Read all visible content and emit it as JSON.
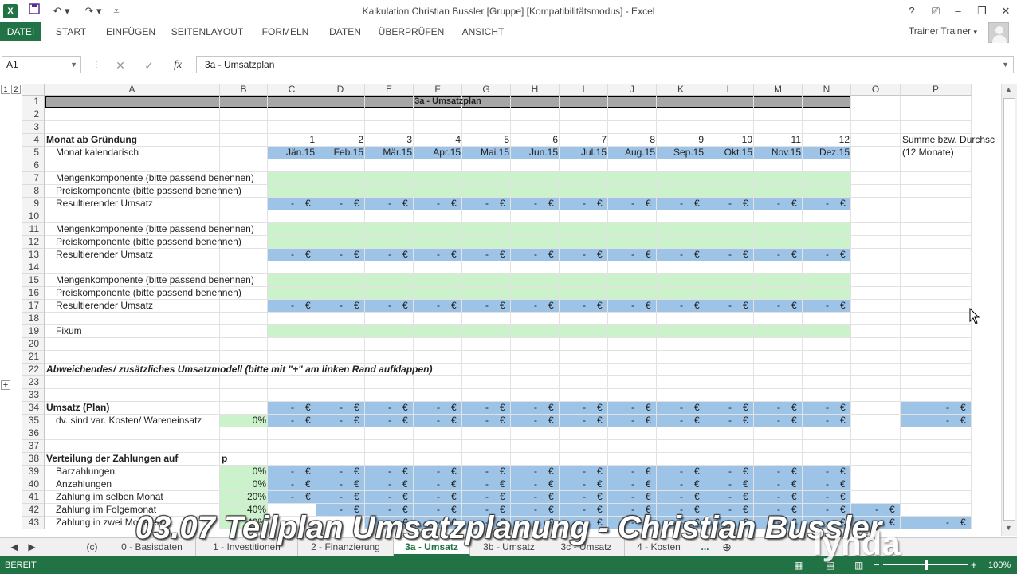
{
  "title_bar": {
    "app_logo": "X",
    "window_title": "Kalkulation Christian Bussler  [Gruppe]  [Kompatibilitätsmodus] - Excel",
    "help": "?",
    "restore_ribbon": "⎚",
    "minimize": "–",
    "maximize": "❐",
    "close": "✕"
  },
  "ribbon": {
    "tabs": [
      "DATEI",
      "START",
      "EINFÜGEN",
      "SEITENLAYOUT",
      "FORMELN",
      "DATEN",
      "ÜBERPRÜFEN",
      "ANSICHT"
    ],
    "active_tab": "DATEI",
    "user": "Trainer Trainer"
  },
  "formula_bar": {
    "name_box": "A1",
    "cancel": "✕",
    "confirm": "✓",
    "fx": "fx",
    "value": "3a - Umsatzplan"
  },
  "outline": {
    "level1": "1",
    "level2": "2",
    "expand": "+"
  },
  "columns": [
    "A",
    "B",
    "C",
    "D",
    "E",
    "F",
    "G",
    "H",
    "I",
    "J",
    "K",
    "L",
    "M",
    "N",
    "O",
    "P"
  ],
  "rows": [
    "1",
    "2",
    "3",
    "4",
    "5",
    "6",
    "7",
    "8",
    "9",
    "10",
    "11",
    "12",
    "13",
    "14",
    "15",
    "16",
    "17",
    "18",
    "19",
    "20",
    "21",
    "22",
    "23",
    "33",
    "34",
    "35",
    "36",
    "37",
    "38",
    "39",
    "40",
    "41",
    "42",
    "43"
  ],
  "cells": {
    "r1_title": "3a - Umsatzplan",
    "r4_a": "Monat ab Gründung",
    "r4_months": [
      "1",
      "2",
      "3",
      "4",
      "5",
      "6",
      "7",
      "8",
      "9",
      "10",
      "11",
      "12"
    ],
    "r4_p": "Summe bzw. Durchschnitt",
    "r5_a": "Monat kalendarisch",
    "r5_months": [
      "Jän.15",
      "Feb.15",
      "Mär.15",
      "Apr.15",
      "Mai.15",
      "Jun.15",
      "Jul.15",
      "Aug.15",
      "Sep.15",
      "Okt.15",
      "Nov.15",
      "Dez.15"
    ],
    "r5_p": "(12 Monate)",
    "r7_a": "Mengenkomponente (bitte passend benennen)",
    "r8_a": "Preiskomponente (bitte passend benennen)",
    "r9_a": "Resultierender Umsatz",
    "r11_a": "Mengenkomponente (bitte passend benennen)",
    "r12_a": "Preiskomponente (bitte passend benennen)",
    "r13_a": "Resultierender Umsatz",
    "r15_a": "Mengenkomponente (bitte passend benennen)",
    "r16_a": "Preiskomponente (bitte passend benennen)",
    "r17_a": "Resultierender Umsatz",
    "r19_a": "Fixum",
    "r22_a": "Abweichendes/ zusätzliches Umsatzmodell (bitte mit \"+\" am linken Rand aufklappen)",
    "r34_a": "Umsatz (Plan)",
    "r35_a": "dv. sind var. Kosten/ Wareneinsatz",
    "r35_b": "0%",
    "r38_a": "Verteilung der Zahlungen auf",
    "r38_b": "p",
    "r39_a": "Barzahlungen",
    "r39_b": "0%",
    "r40_a": "Anzahlungen",
    "r40_b": "0%",
    "r41_a": "Zahlung im selben Monat",
    "r41_b": "20%",
    "r42_a": "Zahlung im Folgemonat",
    "r42_b": "40%",
    "r43_a": "Zahlung in zwei Monaten",
    "r43_b": "40%",
    "dash": "-",
    "euro": "€"
  },
  "sheet_tabs": [
    "(c)",
    "0 - Basisdaten",
    "1 - Investitionen",
    "2 - Finanzierung",
    "3a - Umsatz",
    "3b - Umsatz",
    "3c - Umsatz",
    "4 - Kosten",
    "..."
  ],
  "active_sheet": "3a - Umsatz",
  "status": {
    "mode": "BEREIT",
    "zoom": "100%",
    "zoom_minus": "−",
    "zoom_plus": "+"
  },
  "overlay": {
    "caption": "03.07 Teilplan Umsatzplanung - Christian Bussler",
    "brand": "lynda"
  },
  "colors": {
    "excel_green": "#217346",
    "blue_fill": "#9dc3e6",
    "green_fill": "#ccf2cc",
    "title_fill": "#a6a6a6"
  }
}
